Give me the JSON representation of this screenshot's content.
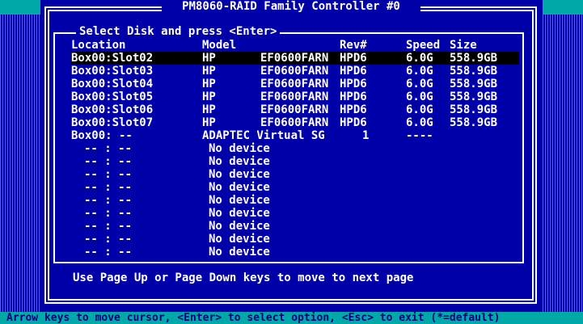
{
  "title": " PM8060-RAID Family Controller #0 ",
  "panel": {
    "title": "Select Disk and press <Enter>",
    "columns": {
      "location": "Location",
      "model": "Model",
      "rev": "Rev#",
      "speed": "Speed",
      "size": "Size"
    },
    "disks": [
      {
        "location": "Box00:Slot02",
        "vendor": "HP",
        "product": "EF0600FARN",
        "rev": "HPD6",
        "speed": "6.0G",
        "size": "558.9GB"
      },
      {
        "location": "Box00:Slot03",
        "vendor": "HP",
        "product": "EF0600FARN",
        "rev": "HPD6",
        "speed": "6.0G",
        "size": "558.9GB"
      },
      {
        "location": "Box00:Slot04",
        "vendor": "HP",
        "product": "EF0600FARN",
        "rev": "HPD6",
        "speed": "6.0G",
        "size": "558.9GB"
      },
      {
        "location": "Box00:Slot05",
        "vendor": "HP",
        "product": "EF0600FARN",
        "rev": "HPD6",
        "speed": "6.0G",
        "size": "558.9GB"
      },
      {
        "location": "Box00:Slot06",
        "vendor": "HP",
        "product": "EF0600FARN",
        "rev": "HPD6",
        "speed": "6.0G",
        "size": "558.9GB"
      },
      {
        "location": "Box00:Slot07",
        "vendor": "HP",
        "product": "EF0600FARN",
        "rev": "HPD6",
        "speed": "6.0G",
        "size": "558.9GB"
      }
    ],
    "virtual": {
      "location": "Box00: --",
      "model": "ADAPTEC Virtual SG",
      "rev": "1",
      "speed": "----"
    },
    "empty_slots": [
      {
        "location": "-- : --",
        "desc": "No device"
      },
      {
        "location": "-- : --",
        "desc": "No device"
      },
      {
        "location": "-- : --",
        "desc": "No device"
      },
      {
        "location": "-- : --",
        "desc": "No device"
      },
      {
        "location": "-- : --",
        "desc": "No device"
      },
      {
        "location": "-- : --",
        "desc": "No device"
      },
      {
        "location": "-- : --",
        "desc": "No device"
      },
      {
        "location": "-- : --",
        "desc": "No device"
      },
      {
        "location": "-- : --",
        "desc": "No device"
      }
    ],
    "hint": "Use Page Up or Page Down keys to move to next page"
  },
  "status_bar": "Arrow keys to move cursor, <Enter> to select option, <Esc> to exit (*=default)",
  "colors": {
    "background": "#0000a8",
    "text": "#ffffff",
    "selection": "#000000",
    "status_bar": "#00a8a8",
    "status_text": "#000080"
  }
}
